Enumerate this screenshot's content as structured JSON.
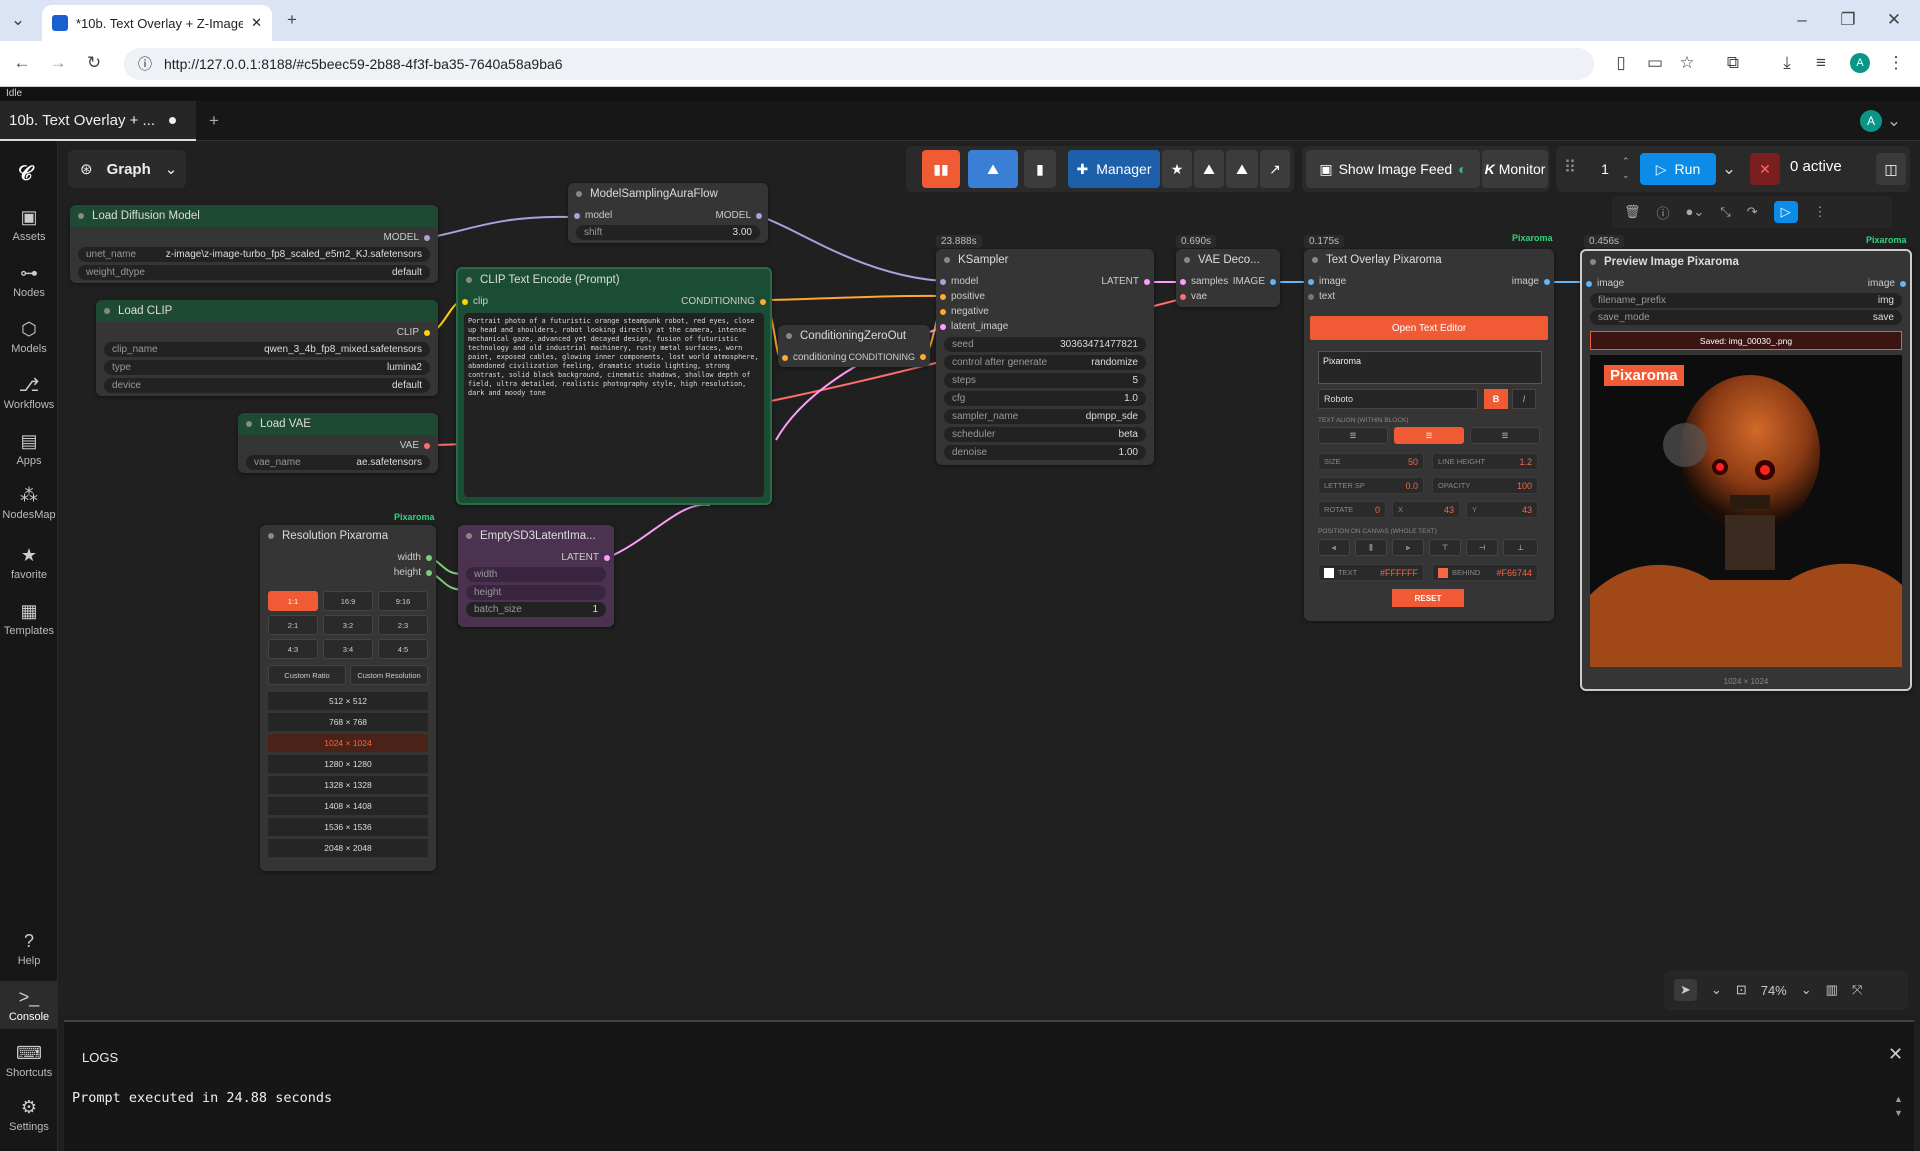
{
  "browser": {
    "tab_title": "*10b. Text Overlay + Z-Image T",
    "url": "http://127.0.0.1:8188/#c5beec59-2b88-4f3f-ba35-7640a58a9ba6",
    "profile": "A"
  },
  "app": {
    "status": "Idle",
    "workflow_tab": "10b. Text Overlay + ...",
    "graph_label": "Graph",
    "user": "A"
  },
  "sidebar": [
    {
      "label": "Assets",
      "icon": "image-icon"
    },
    {
      "label": "Nodes",
      "icon": "nodes-icon"
    },
    {
      "label": "Models",
      "icon": "cube-icon"
    },
    {
      "label": "Workflows",
      "icon": "workflow-icon"
    },
    {
      "label": "Apps",
      "icon": "app-icon"
    },
    {
      "label": "NodesMap",
      "icon": "map-icon"
    },
    {
      "label": "favorite",
      "icon": "star-icon"
    },
    {
      "label": "Templates",
      "icon": "template-icon"
    },
    {
      "label": "Help",
      "icon": "help-icon"
    },
    {
      "label": "Console",
      "icon": "terminal-icon"
    },
    {
      "label": "Shortcuts",
      "icon": "keyboard-icon"
    },
    {
      "label": "Settings",
      "icon": "gear-icon"
    }
  ],
  "toolbar": {
    "manager": "Manager",
    "show_feed": "Show Image Feed",
    "monitor": "Monitor",
    "queue_count": "1",
    "run": "Run",
    "active": "0 active"
  },
  "nodes": {
    "load_diffusion": {
      "title": "Load Diffusion Model",
      "output": "MODEL",
      "unet_label": "unet_name",
      "unet_value": "z-image\\z-image-turbo_fp8_scaled_e5m2_KJ.safetensors",
      "dtype_label": "weight_dtype",
      "dtype_value": "default"
    },
    "load_clip": {
      "title": "Load CLIP",
      "output": "CLIP",
      "name_label": "clip_name",
      "name_value": "qwen_3_4b_fp8_mixed.safetensors",
      "type_label": "type",
      "type_value": "lumina2",
      "device_label": "device",
      "device_value": "default"
    },
    "load_vae": {
      "title": "Load VAE",
      "output": "VAE",
      "name_label": "vae_name",
      "name_value": "ae.safetensors"
    },
    "model_sampling": {
      "title": "ModelSamplingAuraFlow",
      "input": "model",
      "output": "MODEL",
      "shift_label": "shift",
      "shift_value": "3.00"
    },
    "clip_encode": {
      "title": "CLIP Text Encode (Prompt)",
      "input": "clip",
      "output": "CONDITIONING",
      "prompt": "Portrait photo of a futuristic orange steampunk robot, red eyes, close up head and shoulders, robot looking directly at the camera, intense mechanical gaze, advanced yet decayed design, fusion of futuristic technology and old industrial machinery, rusty metal surfaces, worn paint, exposed cables, glowing inner components, lost world atmosphere, abandoned civilization feeling, dramatic studio lighting, strong contrast, solid black background, cinematic shadows, shallow depth of field, ultra detailed, realistic photography style, high resolution, dark and moody tone"
    },
    "cond_zero": {
      "title": "ConditioningZeroOut",
      "input": "conditioning",
      "output": "CONDITIONING"
    },
    "ksampler": {
      "title": "KSampler",
      "badge": "23.888s",
      "output": "LATENT",
      "inputs": [
        "model",
        "positive",
        "negative",
        "latent_image"
      ],
      "widgets": [
        {
          "l": "seed",
          "v": "303634714778​21"
        },
        {
          "l": "control after generate",
          "v": "randomize"
        },
        {
          "l": "steps",
          "v": "5"
        },
        {
          "l": "cfg",
          "v": "1.0"
        },
        {
          "l": "sampler_name",
          "v": "dpmpp_sde"
        },
        {
          "l": "scheduler",
          "v": "beta"
        },
        {
          "l": "denoise",
          "v": "1.00"
        }
      ]
    },
    "vae_decode": {
      "title": "VAE Deco...",
      "badge": "0.690s",
      "input1": "samples",
      "input2": "vae",
      "output": "IMAGE"
    },
    "text_overlay": {
      "title": "Text Overlay Pixaroma",
      "badge": "0.175s",
      "brand": "Pixaroma",
      "input1": "image",
      "input2": "text",
      "output": "image",
      "open_editor": "Open Text Editor",
      "text_value": "Pixaroma",
      "font": "Roboto",
      "bold": "B",
      "italic": "I",
      "align_label": "TEXT ALIGN (WITHIN BLOCK)",
      "size_label": "SIZE",
      "size": "50",
      "lh_label": "LINE HEIGHT",
      "lh": "1.2",
      "ls_label": "LETTER SP",
      "ls": "0.0",
      "op_label": "OPACITY",
      "op": "100",
      "rot_label": "ROTATE",
      "rot": "0",
      "x_label": "X",
      "x": "43",
      "y_label": "Y",
      "y": "43",
      "pos_label": "POSITION ON CANVAS (WHOLE TEXT)",
      "text_color_label": "TEXT",
      "text_color": "#FFFFFF",
      "behind_label": "BEHIND",
      "behind_color": "#F66744",
      "reset": "RESET"
    },
    "preview": {
      "title": "Preview Image Pixaroma",
      "badge": "0.456s",
      "brand": "Pixaroma",
      "input": "image",
      "output": "image",
      "prefix_label": "filename_prefix",
      "prefix_value": "img",
      "mode_label": "save_mode",
      "mode_value": "save",
      "saved": "Saved: img_00030_.png",
      "overlay_text": "Pixaroma",
      "dims": "1024 × 1024"
    },
    "resolution": {
      "title": "Resolution Pixaroma",
      "brand": "Pixaroma",
      "out1": "width",
      "out2": "height",
      "ratios": [
        "1:1",
        "16:9",
        "9:16",
        "2:1",
        "3:2",
        "2:3",
        "4:3",
        "3:4",
        "4:5"
      ],
      "custom_ratio": "Custom Ratio",
      "custom_res": "Custom Resolution",
      "sizes": [
        "512 × 512",
        "768 × 768",
        "1024 × 1024",
        "1280 × 1280",
        "1328 × 1328",
        "1408 × 1408",
        "1536 × 1536",
        "2048 × 2048"
      ]
    },
    "empty_latent": {
      "title": "EmptySD3LatentIma...",
      "output": "LATENT",
      "w": "width",
      "h": "height",
      "batch_label": "batch_size",
      "batch_value": "1"
    }
  },
  "zoom": "74%",
  "logs": {
    "title": "LOGS",
    "message": "Prompt executed in 24.88 seconds"
  },
  "colors": {
    "accent": "#f66744",
    "run": "#0b8ce9",
    "clip_node": "#1a4d34",
    "latent_node": "#4a3250"
  }
}
